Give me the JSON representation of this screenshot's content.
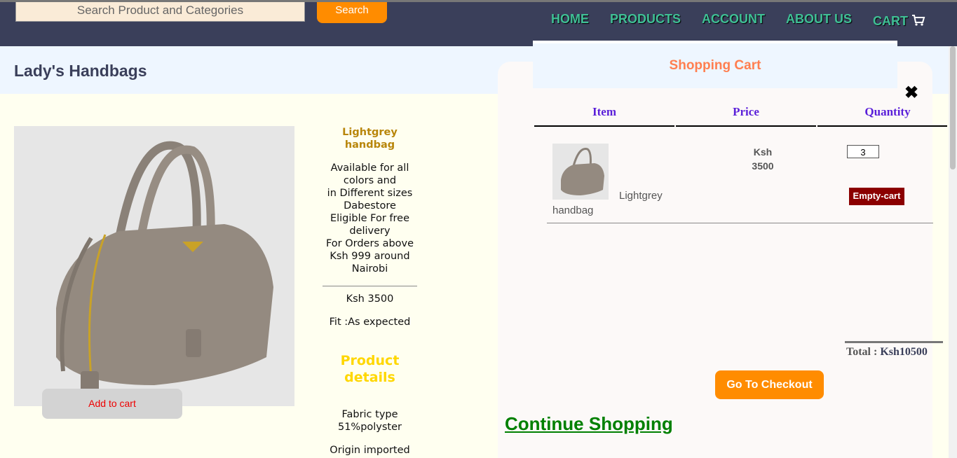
{
  "search": {
    "placeholder": "Search Product and Categories",
    "button_label": "Search"
  },
  "nav": {
    "home": "HOME",
    "products": "PRODUCTS",
    "account": "ACCOUNT",
    "about": "ABOUT US",
    "cart": "CART"
  },
  "page": {
    "title": "Lady's Handbags"
  },
  "product": {
    "name_line1": "Lightgrey",
    "name_line2": "handbag",
    "description_lines": [
      "Available for all",
      "colors and",
      "in Different sizes",
      "Dabestore",
      "Eligible For free",
      "delivery",
      "For Orders above",
      "Ksh 999 around",
      "Nairobi"
    ],
    "price": "Ksh 3500",
    "fit": "Fit :As expected",
    "details_title_1": "Product",
    "details_title_2": "details",
    "fabric_1": "Fabric type",
    "fabric_2": "51%polyster",
    "origin": "Origin imported",
    "add_to_cart": "Add to cart"
  },
  "cart": {
    "title": "Shopping Cart",
    "close_icon": "✖",
    "columns": {
      "item": "Item",
      "price": "Price",
      "quantity": "Quantity"
    },
    "row": {
      "item_name_1": "Lightgrey",
      "item_name_2": "handbag",
      "price_1": "Ksh",
      "price_2": "3500",
      "quantity": "3",
      "empty_label": "Empty-cart"
    },
    "total_label": "Total :",
    "total_value": "Ksh10500",
    "checkout_label": "Go To Checkout",
    "continue_label": "Continue Shopping"
  },
  "colors": {
    "navbar": "#3a3f5a",
    "nav_link": "#3fbf95",
    "accent_orange": "#ff8c00",
    "cart_title": "#ff7f50",
    "continue": "#008000"
  }
}
